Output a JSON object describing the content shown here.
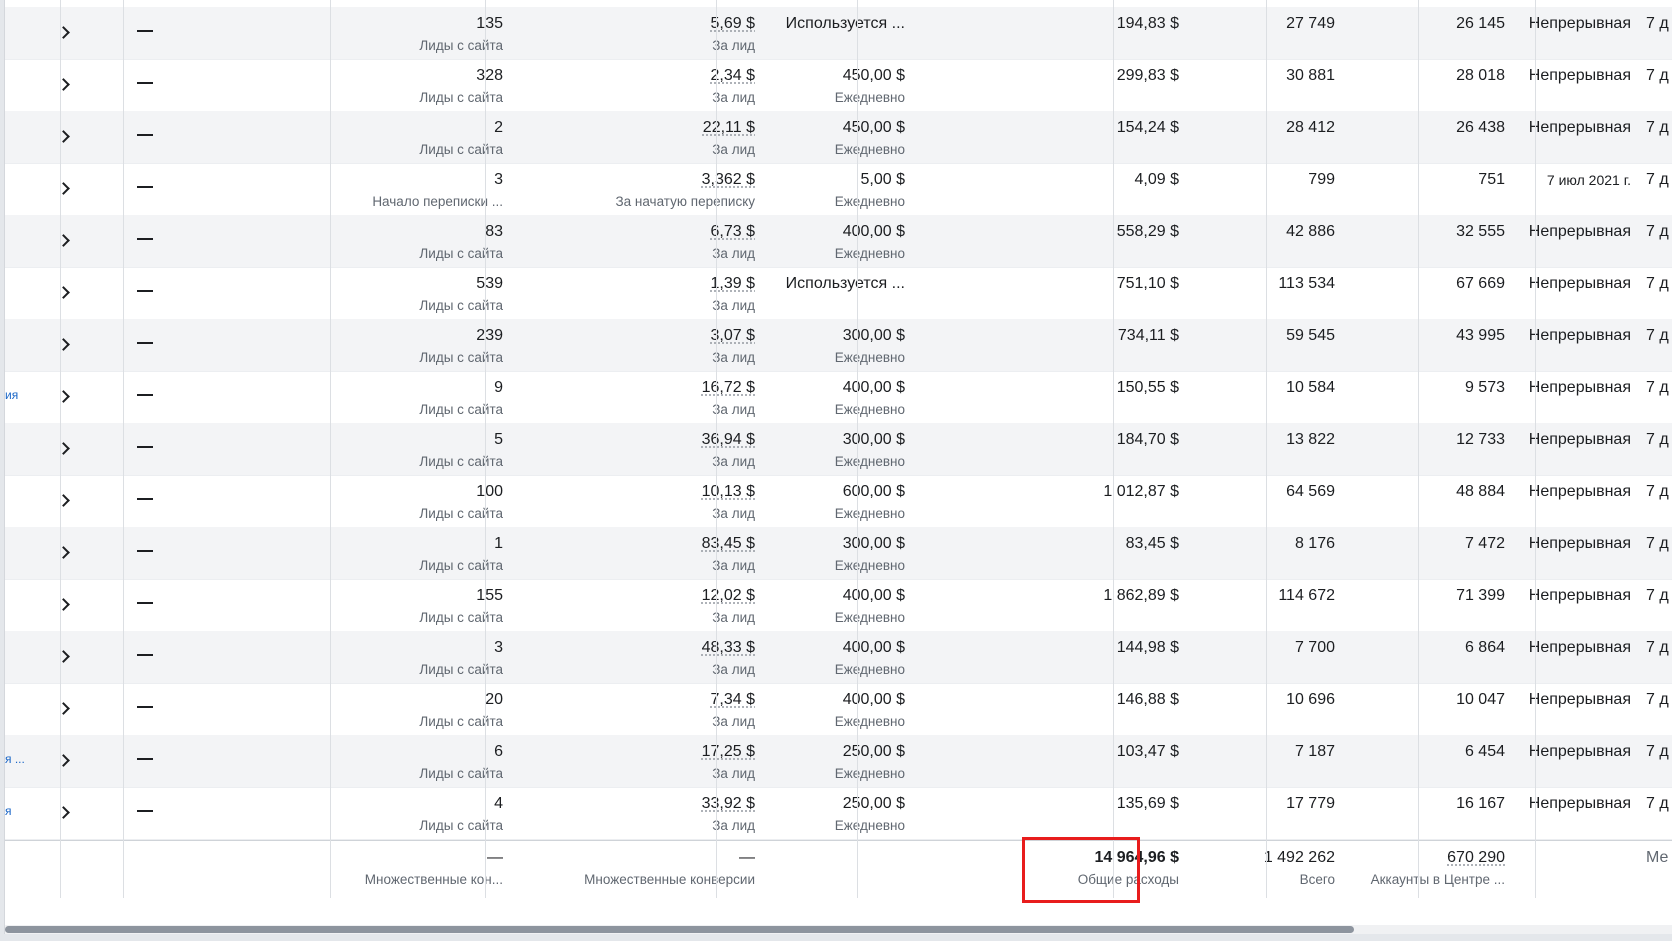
{
  "rows": [
    {
      "name": "",
      "results": "135",
      "results_label": "Лиды с сайта",
      "cost": "5,69 $",
      "cost_label": "За лид",
      "budget": "Используется ...",
      "budget_label": "",
      "spent": "194,83 $",
      "impressions": "27 749",
      "reach": "26 145",
      "end": "Непрерывная",
      "sched": "7 д"
    },
    {
      "name": "",
      "results": "328",
      "results_label": "Лиды с сайта",
      "cost": "2,34 $",
      "cost_label": "За лид",
      "budget": "450,00 $",
      "budget_label": "Ежедневно",
      "spent": "299,83 $",
      "impressions": "30 881",
      "reach": "28 018",
      "end": "Непрерывная",
      "sched": "7 д"
    },
    {
      "name": "",
      "results": "2",
      "results_label": "Лиды с сайта",
      "cost": "22,11 $",
      "cost_label": "За лид",
      "budget": "450,00 $",
      "budget_label": "Ежедневно",
      "spent": "154,24 $",
      "impressions": "28 412",
      "reach": "26 438",
      "end": "Непрерывная",
      "sched": "7 д"
    },
    {
      "name": "",
      "results": "3",
      "results_label": "Начало переписки ...",
      "cost": "3,362 $",
      "cost_label": "За начатую переписку",
      "budget": "5,00 $",
      "budget_label": "Ежедневно",
      "spent": "4,09 $",
      "impressions": "799",
      "reach": "751",
      "end": "7 июл 2021 г.",
      "sched": "7 д"
    },
    {
      "name": "",
      "results": "83",
      "results_label": "Лиды с сайта",
      "cost": "6,73 $",
      "cost_label": "За лид",
      "budget": "400,00 $",
      "budget_label": "Ежедневно",
      "spent": "558,29 $",
      "impressions": "42 886",
      "reach": "32 555",
      "end": "Непрерывная",
      "sched": "7 д"
    },
    {
      "name": "",
      "results": "539",
      "results_label": "Лиды с сайта",
      "cost": "1,39 $",
      "cost_label": "За лид",
      "budget": "Используется ...",
      "budget_label": "",
      "spent": "751,10 $",
      "impressions": "113 534",
      "reach": "67 669",
      "end": "Непрерывная",
      "sched": "7 д"
    },
    {
      "name": "",
      "results": "239",
      "results_label": "Лиды с сайта",
      "cost": "3,07 $",
      "cost_label": "За лид",
      "budget": "300,00 $",
      "budget_label": "Ежедневно",
      "spent": "734,11 $",
      "impressions": "59 545",
      "reach": "43 995",
      "end": "Непрерывная",
      "sched": "7 д"
    },
    {
      "name": "ия",
      "results": "9",
      "results_label": "Лиды с сайта",
      "cost": "16,72 $",
      "cost_label": "За лид",
      "budget": "400,00 $",
      "budget_label": "Ежедневно",
      "spent": "150,55 $",
      "impressions": "10 584",
      "reach": "9 573",
      "end": "Непрерывная",
      "sched": "7 д"
    },
    {
      "name": "",
      "results": "5",
      "results_label": "Лиды с сайта",
      "cost": "36,94 $",
      "cost_label": "За лид",
      "budget": "300,00 $",
      "budget_label": "Ежедневно",
      "spent": "184,70 $",
      "impressions": "13 822",
      "reach": "12 733",
      "end": "Непрерывная",
      "sched": "7 д"
    },
    {
      "name": "",
      "results": "100",
      "results_label": "Лиды с сайта",
      "cost": "10,13 $",
      "cost_label": "За лид",
      "budget": "600,00 $",
      "budget_label": "Ежедневно",
      "spent": "1 012,87 $",
      "impressions": "64 569",
      "reach": "48 884",
      "end": "Непрерывная",
      "sched": "7 д"
    },
    {
      "name": "",
      "results": "1",
      "results_label": "Лиды с сайта",
      "cost": "83,45 $",
      "cost_label": "За лид",
      "budget": "300,00 $",
      "budget_label": "Ежедневно",
      "spent": "83,45 $",
      "impressions": "8 176",
      "reach": "7 472",
      "end": "Непрерывная",
      "sched": "7 д"
    },
    {
      "name": "",
      "results": "155",
      "results_label": "Лиды с сайта",
      "cost": "12,02 $",
      "cost_label": "За лид",
      "budget": "400,00 $",
      "budget_label": "Ежедневно",
      "spent": "1 862,89 $",
      "impressions": "114 672",
      "reach": "71 399",
      "end": "Непрерывная",
      "sched": "7 д"
    },
    {
      "name": "",
      "results": "3",
      "results_label": "Лиды с сайта",
      "cost": "48,33 $",
      "cost_label": "За лид",
      "budget": "400,00 $",
      "budget_label": "Ежедневно",
      "spent": "144,98 $",
      "impressions": "7 700",
      "reach": "6 864",
      "end": "Непрерывная",
      "sched": "7 д"
    },
    {
      "name": "",
      "results": "20",
      "results_label": "Лиды с сайта",
      "cost": "7,34 $",
      "cost_label": "За лид",
      "budget": "400,00 $",
      "budget_label": "Ежедневно",
      "spent": "146,88 $",
      "impressions": "10 696",
      "reach": "10 047",
      "end": "Непрерывная",
      "sched": "7 д"
    },
    {
      "name": "я ...",
      "results": "6",
      "results_label": "Лиды с сайта",
      "cost": "17,25 $",
      "cost_label": "За лид",
      "budget": "250,00 $",
      "budget_label": "Ежедневно",
      "spent": "103,47 $",
      "impressions": "7 187",
      "reach": "6 454",
      "end": "Непрерывная",
      "sched": "7 д"
    },
    {
      "name": "я",
      "results": "4",
      "results_label": "Лиды с сайта",
      "cost": "33,92 $",
      "cost_label": "За лид",
      "budget": "250,00 $",
      "budget_label": "Ежедневно",
      "spent": "135,69 $",
      "impressions": "17 779",
      "reach": "16 167",
      "end": "Непрерывная",
      "sched": "7 д"
    }
  ],
  "totals": {
    "results": "—",
    "results_label": "Множественные кон...",
    "cost": "—",
    "cost_label": "Множественные конверсии",
    "spent": "14 964,96 $",
    "spent_label": "Общие расходы",
    "impressions": "1 492 262",
    "impressions_label": "Всего",
    "reach": "670 290",
    "reach_label": "Аккаунты в Центре ...",
    "sched": "Ме"
  },
  "colors": {
    "highlight": "#e81c1c",
    "link": "#1a66c7"
  }
}
